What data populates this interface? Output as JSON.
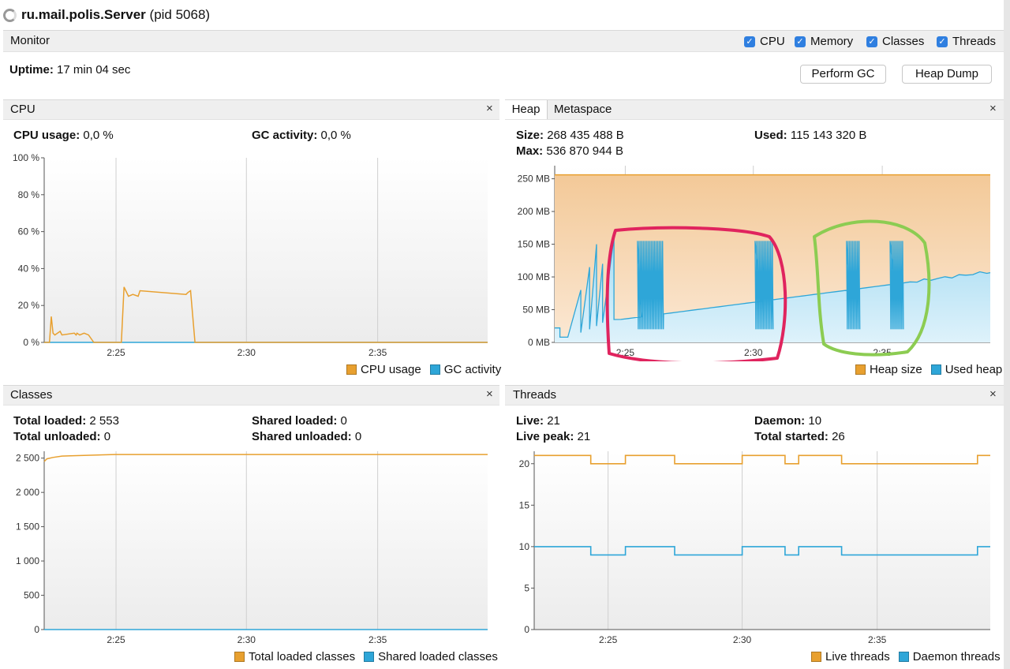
{
  "title": {
    "name": "ru.mail.polis.Server",
    "pid": "(pid 5068)"
  },
  "monitor": {
    "label": "Monitor",
    "checks": [
      "CPU",
      "Memory",
      "Classes",
      "Threads"
    ],
    "uptime_label": "Uptime:",
    "uptime_value": "17 min 04 sec",
    "perform_gc": "Perform GC",
    "heap_dump": "Heap Dump"
  },
  "colors": {
    "orange": "#e8a02f",
    "blue": "#2ea6d8",
    "red_marker": "#e0245e",
    "green_marker": "#8ccc52"
  },
  "cpu": {
    "title": "CPU",
    "usage_label": "CPU usage:",
    "usage_value": "0,0 %",
    "gc_label": "GC activity:",
    "gc_value": "0,0 %",
    "legend": [
      "CPU usage",
      "GC activity"
    ],
    "yticks": [
      "100 %",
      "80 %",
      "60 %",
      "40 %",
      "20 %",
      "0 %"
    ],
    "xticks": [
      "2:25",
      "2:30",
      "2:35"
    ]
  },
  "heap": {
    "tabs": [
      "Heap",
      "Metaspace"
    ],
    "size_label": "Size:",
    "size_value": "268 435 488 B",
    "used_label": "Used:",
    "used_value": "115 143 320 B",
    "max_label": "Max:",
    "max_value": "536 870 944 B",
    "legend": [
      "Heap size",
      "Used heap"
    ],
    "yticks": [
      "250 MB",
      "200 MB",
      "150 MB",
      "100 MB",
      "50 MB",
      "0 MB"
    ],
    "xticks": [
      "2:25",
      "2:30",
      "2:35"
    ]
  },
  "classes": {
    "title": "Classes",
    "total_loaded_label": "Total loaded:",
    "total_loaded_value": "2 553",
    "total_unloaded_label": "Total unloaded:",
    "total_unloaded_value": "0",
    "shared_loaded_label": "Shared loaded:",
    "shared_loaded_value": "0",
    "shared_unloaded_label": "Shared unloaded:",
    "shared_unloaded_value": "0",
    "legend": [
      "Total loaded classes",
      "Shared loaded classes"
    ],
    "yticks": [
      "2 500",
      "2 000",
      "1 500",
      "1 000",
      "500",
      "0"
    ],
    "xticks": [
      "2:25",
      "2:30",
      "2:35"
    ]
  },
  "threads": {
    "title": "Threads",
    "live_label": "Live:",
    "live_value": "21",
    "live_peak_label": "Live peak:",
    "live_peak_value": "21",
    "daemon_label": "Daemon:",
    "daemon_value": "10",
    "total_started_label": "Total started:",
    "total_started_value": "26",
    "legend": [
      "Live threads",
      "Daemon threads"
    ],
    "yticks": [
      "20",
      "15",
      "10",
      "5",
      "0"
    ],
    "xticks": [
      "2:25",
      "2:30",
      "2:35"
    ]
  },
  "chart_data": [
    {
      "type": "line",
      "ylim": [
        0,
        100
      ],
      "series": [
        {
          "name": "CPU usage",
          "x": [
            0,
            0.6,
            0.8,
            1,
            1.2,
            1.8,
            2,
            3.4,
            3.6,
            3.7,
            4,
            4.5,
            5,
            5.6,
            5.8,
            6.3,
            6.5,
            8.5,
            8.7,
            9,
            9.5,
            10,
            10.6,
            10.8,
            16,
            16.2,
            16.5,
            17,
            18,
            18.4,
            18.6,
            24,
            24.2,
            25,
            26,
            26.5,
            27,
            27.5,
            28,
            28.6,
            28.8,
            32.6,
            32.8,
            33.2,
            33.5,
            34,
            34.4,
            34.6,
            34.8,
            35,
            35.7,
            36,
            36.5,
            37,
            37.4,
            37.6,
            40.5,
            41,
            50
          ],
          "y": [
            0,
            0,
            14,
            5,
            4,
            6,
            4,
            5,
            4,
            5,
            4,
            5,
            4,
            0,
            0,
            0,
            0,
            0,
            0,
            30,
            25,
            26,
            25,
            28,
            26,
            27,
            28,
            0,
            0,
            0,
            0,
            0,
            0,
            0,
            0,
            0,
            0,
            0,
            0,
            0,
            0,
            0,
            0,
            0,
            0,
            0,
            0,
            0,
            0,
            0,
            0,
            0,
            0,
            0,
            0,
            0,
            0,
            0,
            0
          ]
        },
        {
          "name": "GC activity",
          "x": [
            0,
            50
          ],
          "y": [
            0,
            0
          ]
        }
      ]
    },
    {
      "type": "area",
      "ylim": [
        0,
        270
      ],
      "series": [
        {
          "name": "Heap size",
          "x": [
            0,
            50
          ],
          "y": [
            256,
            256
          ]
        },
        {
          "name": "Used heap",
          "x": [
            0,
            50
          ],
          "y": [
            22,
            108
          ]
        }
      ]
    },
    {
      "type": "line",
      "ylim": [
        0,
        2600
      ],
      "series": [
        {
          "name": "Total loaded classes",
          "x": [
            0,
            0.3,
            1,
            2,
            3,
            8,
            50
          ],
          "y": [
            2450,
            2490,
            2510,
            2530,
            2535,
            2553,
            2553
          ]
        },
        {
          "name": "Shared loaded classes",
          "x": [
            0,
            50
          ],
          "y": [
            0,
            0
          ]
        }
      ]
    },
    {
      "type": "line",
      "ylim": [
        0,
        21.5
      ],
      "series": [
        {
          "name": "Live threads",
          "x": [
            0,
            6.2,
            6.2,
            10,
            10,
            15.4,
            15.4,
            22.8,
            22.8,
            27.5,
            27.5,
            29,
            29,
            33.7,
            33.7,
            48.6,
            48.6,
            50
          ],
          "y": [
            21,
            21,
            20,
            20,
            21,
            21,
            20,
            20,
            21,
            21,
            20,
            20,
            21,
            21,
            20,
            20,
            21,
            21
          ]
        },
        {
          "name": "Daemon threads",
          "x": [
            0,
            6.2,
            6.2,
            10,
            10,
            15.4,
            15.4,
            22.8,
            22.8,
            27.5,
            27.5,
            29,
            29,
            33.7,
            33.7,
            48.6,
            48.6,
            50
          ],
          "y": [
            10,
            10,
            9,
            9,
            10,
            10,
            9,
            9,
            10,
            10,
            9,
            9,
            10,
            10,
            9,
            9,
            10,
            10
          ]
        }
      ]
    }
  ]
}
